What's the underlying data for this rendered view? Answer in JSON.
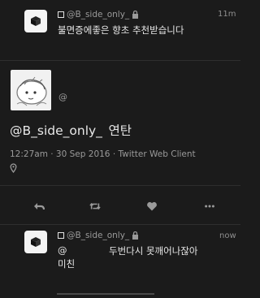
{
  "top_tweet": {
    "handle": "@B_side_only_",
    "time": "11m",
    "text": "불면증에좋은 향초 추천받습니다"
  },
  "quoted_card": {
    "handle": "@"
  },
  "main_tweet": {
    "mention": "@B_side_only_",
    "text": "연탄",
    "timestamp": "12:27am · 30 Sep 2016 · Twitter Web Client"
  },
  "actions": {
    "reply_icon": "reply-icon",
    "retweet_icon": "retweet-icon",
    "like_icon": "heart-icon",
    "more_icon": "more-icon"
  },
  "reply_tweet": {
    "handle": "@B_side_only_",
    "time": "now",
    "mention": "@",
    "text_line1": "두번다시 못깨어나잖아",
    "text_line2": "미친"
  },
  "colors": {
    "background": "#1b1b1b",
    "link": "#6fa5d6",
    "text": "#e8e8e8",
    "muted": "#9a9a9a"
  }
}
